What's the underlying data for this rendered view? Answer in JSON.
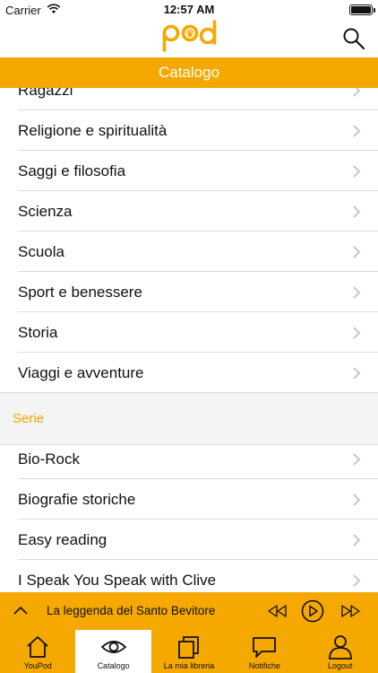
{
  "status_bar": {
    "carrier": "Carrier",
    "time": "12:57 AM"
  },
  "header": {
    "logo_text": "pod",
    "title": "Catalogo",
    "search_icon": "search-icon"
  },
  "categories": [
    {
      "label": "Ragazzi"
    },
    {
      "label": "Religione e spiritualità"
    },
    {
      "label": "Saggi e filosofia"
    },
    {
      "label": "Scienza"
    },
    {
      "label": "Scuola"
    },
    {
      "label": "Sport e benessere"
    },
    {
      "label": "Storia"
    },
    {
      "label": "Viaggi e avventure"
    }
  ],
  "series_section": {
    "header": "Serie",
    "items": [
      {
        "label": "Bio-Rock"
      },
      {
        "label": "Biografie storiche"
      },
      {
        "label": "Easy reading"
      },
      {
        "label": "I Speak You Speak with Clive"
      }
    ]
  },
  "player": {
    "track_title": "La leggenda del Santo Bevitore",
    "icons": [
      "chevron-up-icon",
      "rewind-icon",
      "play-icon",
      "fast-forward-icon"
    ]
  },
  "tabs": [
    {
      "label": "YouPod",
      "icon": "home-icon",
      "active": false
    },
    {
      "label": "Catalogo",
      "icon": "eye-icon",
      "active": true
    },
    {
      "label": "La mia libreria",
      "icon": "library-icon",
      "active": false
    },
    {
      "label": "Notifiche",
      "icon": "chat-bubble-icon",
      "active": false
    },
    {
      "label": "Logout",
      "icon": "user-icon",
      "active": false
    }
  ],
  "colors": {
    "accent": "#f5a800",
    "section_background": "#f4f4f4",
    "separator": "#dcdcdc",
    "text": "#111111"
  }
}
